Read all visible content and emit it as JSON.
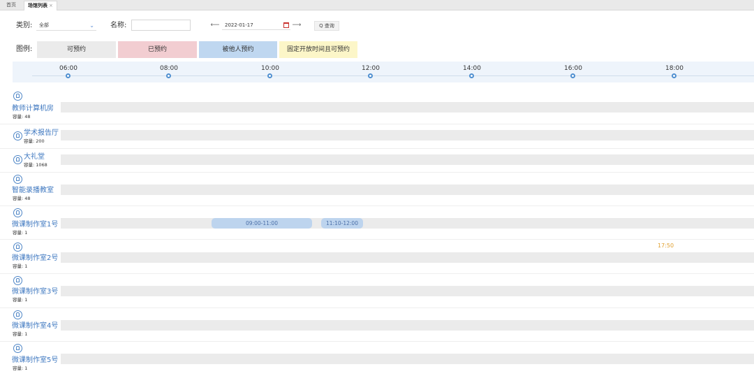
{
  "tabs": [
    {
      "label": "首页"
    },
    {
      "label": "场馆列表",
      "close": "×"
    }
  ],
  "filters": {
    "category_label": "类别:",
    "category_value": "全部",
    "category_chevron": "⌄",
    "name_label": "名称:",
    "name_value": "",
    "prev": "⟵",
    "date_value": "2022-01-17",
    "next": "⟶",
    "search_label": "Q 查询"
  },
  "legend": {
    "label": "图例:",
    "items": [
      {
        "label": "可预约",
        "color": "#ebebeb"
      },
      {
        "label": "已预约",
        "color": "#f2cdd1"
      },
      {
        "label": "被他人预约",
        "color": "#bfd7f0"
      },
      {
        "label": "固定开放时间且可预约",
        "color": "#fcf6c8"
      }
    ]
  },
  "timeline": {
    "ticks": [
      "06:00",
      "08:00",
      "10:00",
      "12:00",
      "14:00",
      "16:00",
      "18:00"
    ]
  },
  "rooms": [
    {
      "name": "教师计算机房",
      "capacity": "容量: 48"
    },
    {
      "name": "学术报告厅",
      "capacity": "容量: 200"
    },
    {
      "name": "大礼堂",
      "capacity": "容量: 1068"
    },
    {
      "name": "智能录播教室",
      "capacity": "容量: 48"
    },
    {
      "name": "微课制作室1号",
      "capacity": "容量: 1",
      "bookings": [
        "09:00-11:00",
        "11:10-12:00"
      ]
    },
    {
      "name": "微课制作室2号",
      "capacity": "容量: 1",
      "current_time": "17:50"
    },
    {
      "name": "微课制作室3号",
      "capacity": "容量: 1"
    },
    {
      "name": "微课制作室4号",
      "capacity": "容量: 1"
    },
    {
      "name": "微课制作室5号",
      "capacity": "容量: 1"
    }
  ]
}
